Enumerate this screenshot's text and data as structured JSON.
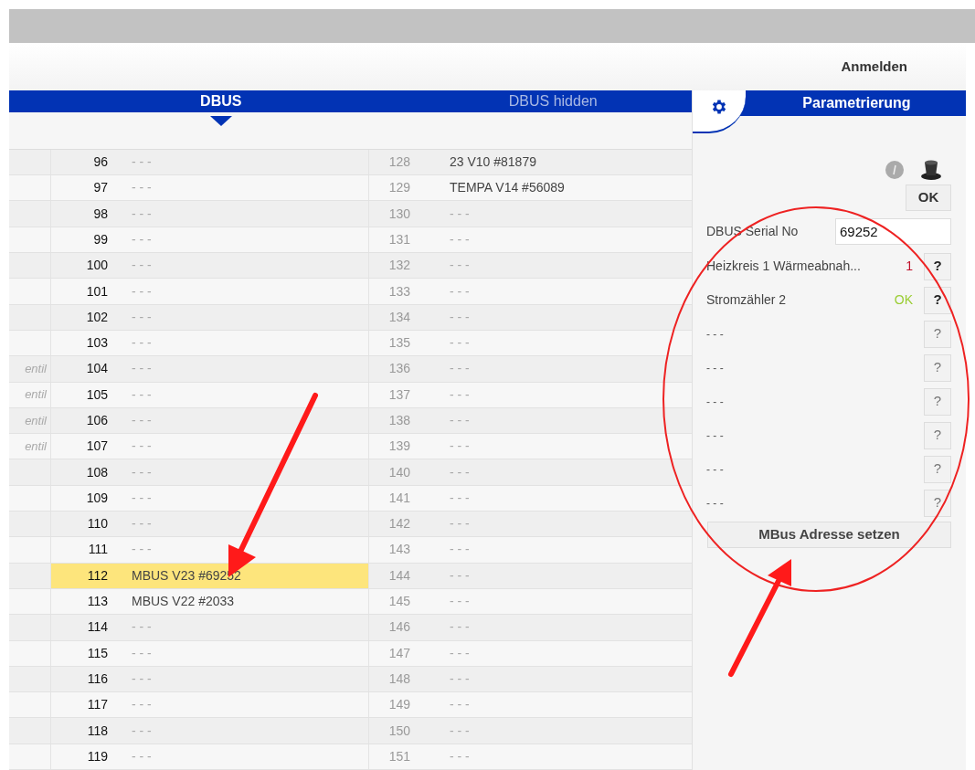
{
  "header": {
    "login": "Anmelden"
  },
  "tabs": [
    {
      "label": "DBUS",
      "selected": true
    },
    {
      "label": "DBUS hidden",
      "selected": false
    }
  ],
  "table": {
    "rows": [
      {
        "num": "96",
        "value": "- - -",
        "empty": true,
        "num2": "128",
        "value2": "23 V10 #81879",
        "empty2": false,
        "highlighted": false
      },
      {
        "num": "97",
        "value": "- - -",
        "empty": true,
        "num2": "129",
        "value2": "TEMPA V14 #56089",
        "empty2": false,
        "highlighted": false
      },
      {
        "num": "98",
        "value": "- - -",
        "empty": true,
        "num2": "130",
        "value2": "- - -",
        "empty2": true,
        "highlighted": false
      },
      {
        "num": "99",
        "value": "- - -",
        "empty": true,
        "num2": "131",
        "value2": "- - -",
        "empty2": true,
        "highlighted": false
      },
      {
        "num": "100",
        "value": "- - -",
        "empty": true,
        "num2": "132",
        "value2": "- - -",
        "empty2": true,
        "highlighted": false
      },
      {
        "num": "101",
        "value": "- - -",
        "empty": true,
        "num2": "133",
        "value2": "- - -",
        "empty2": true,
        "highlighted": false
      },
      {
        "num": "102",
        "value": "- - -",
        "empty": true,
        "num2": "134",
        "value2": "- - -",
        "empty2": true,
        "highlighted": false
      },
      {
        "num": "103",
        "value": "- - -",
        "empty": true,
        "num2": "135",
        "value2": "- - -",
        "empty2": true,
        "highlighted": false
      },
      {
        "left": "entil",
        "num": "104",
        "value": "- - -",
        "empty": true,
        "num2": "136",
        "value2": "- - -",
        "empty2": true,
        "highlighted": false
      },
      {
        "left": "entil",
        "num": "105",
        "value": "- - -",
        "empty": true,
        "num2": "137",
        "value2": "- - -",
        "empty2": true,
        "highlighted": false
      },
      {
        "left": "entil",
        "num": "106",
        "value": "- - -",
        "empty": true,
        "num2": "138",
        "value2": "- - -",
        "empty2": true,
        "highlighted": false
      },
      {
        "left": "entil",
        "num": "107",
        "value": "- - -",
        "empty": true,
        "num2": "139",
        "value2": "- - -",
        "empty2": true,
        "highlighted": false
      },
      {
        "num": "108",
        "value": "- - -",
        "empty": true,
        "num2": "140",
        "value2": "- - -",
        "empty2": true,
        "highlighted": false
      },
      {
        "num": "109",
        "value": "- - -",
        "empty": true,
        "num2": "141",
        "value2": "- - -",
        "empty2": true,
        "highlighted": false
      },
      {
        "num": "110",
        "value": "- - -",
        "empty": true,
        "num2": "142",
        "value2": "- - -",
        "empty2": true,
        "highlighted": false
      },
      {
        "num": "111",
        "value": "- - -",
        "empty": true,
        "num2": "143",
        "value2": "- - -",
        "empty2": true,
        "highlighted": false
      },
      {
        "num": "112",
        "value": "MBUS V23 #69252",
        "empty": false,
        "num2": "144",
        "value2": "- - -",
        "empty2": true,
        "highlighted": true
      },
      {
        "num": "113",
        "value": "MBUS V22 #2033",
        "empty": false,
        "num2": "145",
        "value2": "- - -",
        "empty2": true,
        "highlighted": false
      },
      {
        "num": "114",
        "value": "- - -",
        "empty": true,
        "num2": "146",
        "value2": "- - -",
        "empty2": true,
        "highlighted": false
      },
      {
        "num": "115",
        "value": "- - -",
        "empty": true,
        "num2": "147",
        "value2": "- - -",
        "empty2": true,
        "highlighted": false
      },
      {
        "num": "116",
        "value": "- - -",
        "empty": true,
        "num2": "148",
        "value2": "- - -",
        "empty2": true,
        "highlighted": false
      },
      {
        "num": "117",
        "value": "- - -",
        "empty": true,
        "num2": "149",
        "value2": "- - -",
        "empty2": true,
        "highlighted": false
      },
      {
        "num": "118",
        "value": "- - -",
        "empty": true,
        "num2": "150",
        "value2": "- - -",
        "empty2": true,
        "highlighted": false
      },
      {
        "num": "119",
        "value": "- - -",
        "empty": true,
        "num2": "151",
        "value2": "- - -",
        "empty2": true,
        "highlighted": false
      }
    ]
  },
  "panel": {
    "title": "Parametrierung",
    "ok_button": "OK",
    "serial": {
      "label": "DBUS Serial No",
      "value": "69252"
    },
    "channels": [
      {
        "label": "Heizkreis 1 Wärmeabnah...",
        "status": "1",
        "kind": "error",
        "help": "?",
        "enabled": true
      },
      {
        "label": "Stromzähler 2",
        "status": "OK",
        "kind": "ok",
        "help": "?",
        "enabled": true
      },
      {
        "label": "- - -",
        "kind": "none",
        "help": "?",
        "enabled": false
      },
      {
        "label": "- - -",
        "kind": "none",
        "help": "?",
        "enabled": false
      },
      {
        "label": "- - -",
        "kind": "none",
        "help": "?",
        "enabled": false
      },
      {
        "label": "- - -",
        "kind": "none",
        "help": "?",
        "enabled": false
      },
      {
        "label": "- - -",
        "kind": "none",
        "help": "?",
        "enabled": false
      },
      {
        "label": "- - -",
        "kind": "none",
        "help": "?",
        "enabled": false
      }
    ],
    "address_button": "MBus Adresse setzen"
  }
}
